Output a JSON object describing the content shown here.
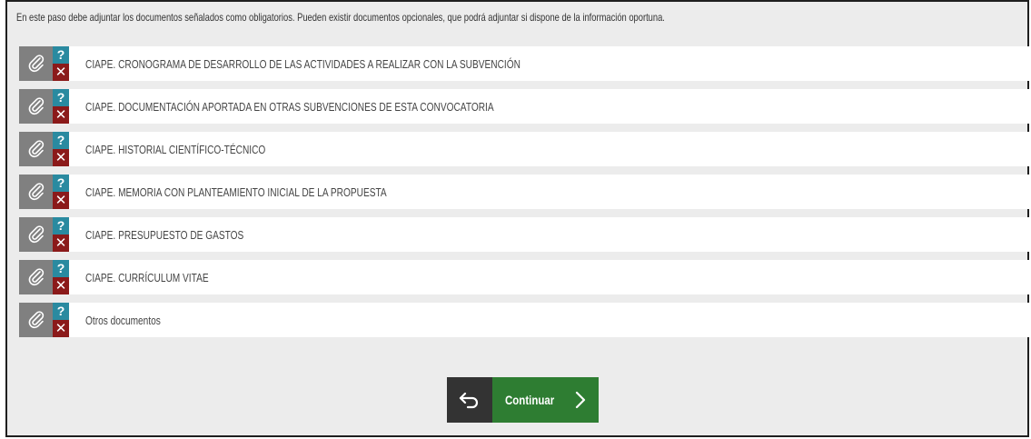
{
  "instructions": "En este paso debe adjuntar los documentos señalados como obligatorios. Pueden existir documentos opcionales, que podrá adjuntar si dispone de la información oportuna.",
  "documents": [
    {
      "label": "CIAPE. CRONOGRAMA DE DESARROLLO DE LAS ACTIVIDADES A REALIZAR CON LA SUBVENCIÓN"
    },
    {
      "label": "CIAPE. DOCUMENTACIÓN APORTADA EN OTRAS SUBVENCIONES DE ESTA CONVOCATORIA"
    },
    {
      "label": "CIAPE. HISTORIAL CIENTÍFICO-TÉCNICO"
    },
    {
      "label": "CIAPE. MEMORIA CON PLANTEAMIENTO INICIAL DE LA PROPUESTA"
    },
    {
      "label": "CIAPE. PRESUPUESTO DE GASTOS"
    },
    {
      "label": "CIAPE. CURRÍCULUM VITAE"
    },
    {
      "label": "Otros documentos"
    }
  ],
  "icons": {
    "attach": "paperclip-icon",
    "help": "?",
    "delete": "✕",
    "back": "back-arrow-icon",
    "next": "chevron-right-icon"
  },
  "buttons": {
    "continue_label": "Continuar"
  },
  "colors": {
    "help_bg": "#2a8aa0",
    "delete_bg": "#8b1a1a",
    "attach_bg": "#808080",
    "back_bg": "#333333",
    "continue_bg": "#2e7d32"
  }
}
